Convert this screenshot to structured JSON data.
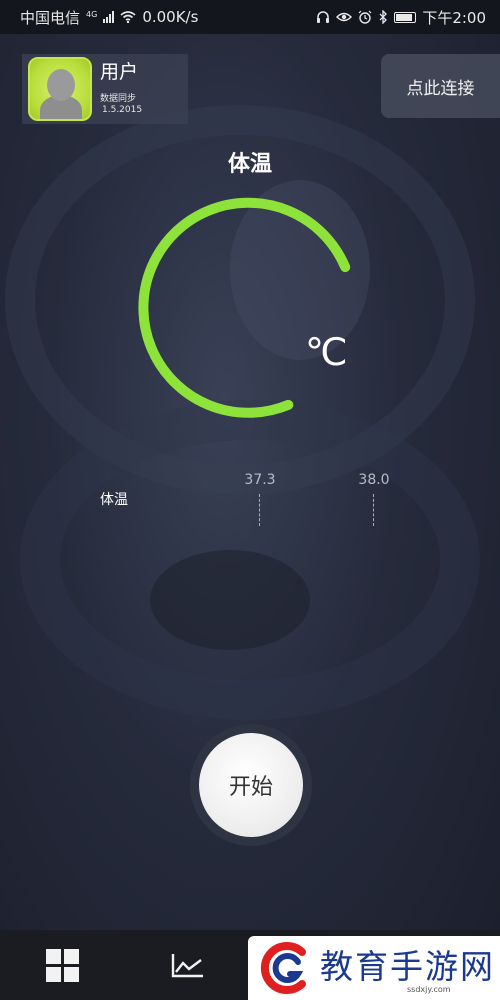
{
  "status_bar": {
    "carrier": "中国电信",
    "network": "4G",
    "speed": "0.00K/s",
    "icons": [
      "headphones-icon",
      "eye-icon",
      "alarm-icon",
      "bluetooth-icon",
      "battery-icon"
    ],
    "time": "下午2:00"
  },
  "user": {
    "name": "用户",
    "sync_label": "数据同步",
    "version": "1.5.2015"
  },
  "connect_button": "点此连接",
  "title": "体温",
  "gauge": {
    "unit": "℃",
    "arc_color": "#8ee33a"
  },
  "scale": {
    "label": "体温",
    "ticks": [
      "37.3",
      "38.0"
    ]
  },
  "start_button": "开始",
  "bottom_nav": {
    "icons": [
      "dashboard-grid-icon",
      "line-chart-icon"
    ]
  },
  "watermark": {
    "text": "教育手游网",
    "url": "ssdxjy.com"
  },
  "colors": {
    "accent": "#8ee33a",
    "background": "#262b3c"
  }
}
